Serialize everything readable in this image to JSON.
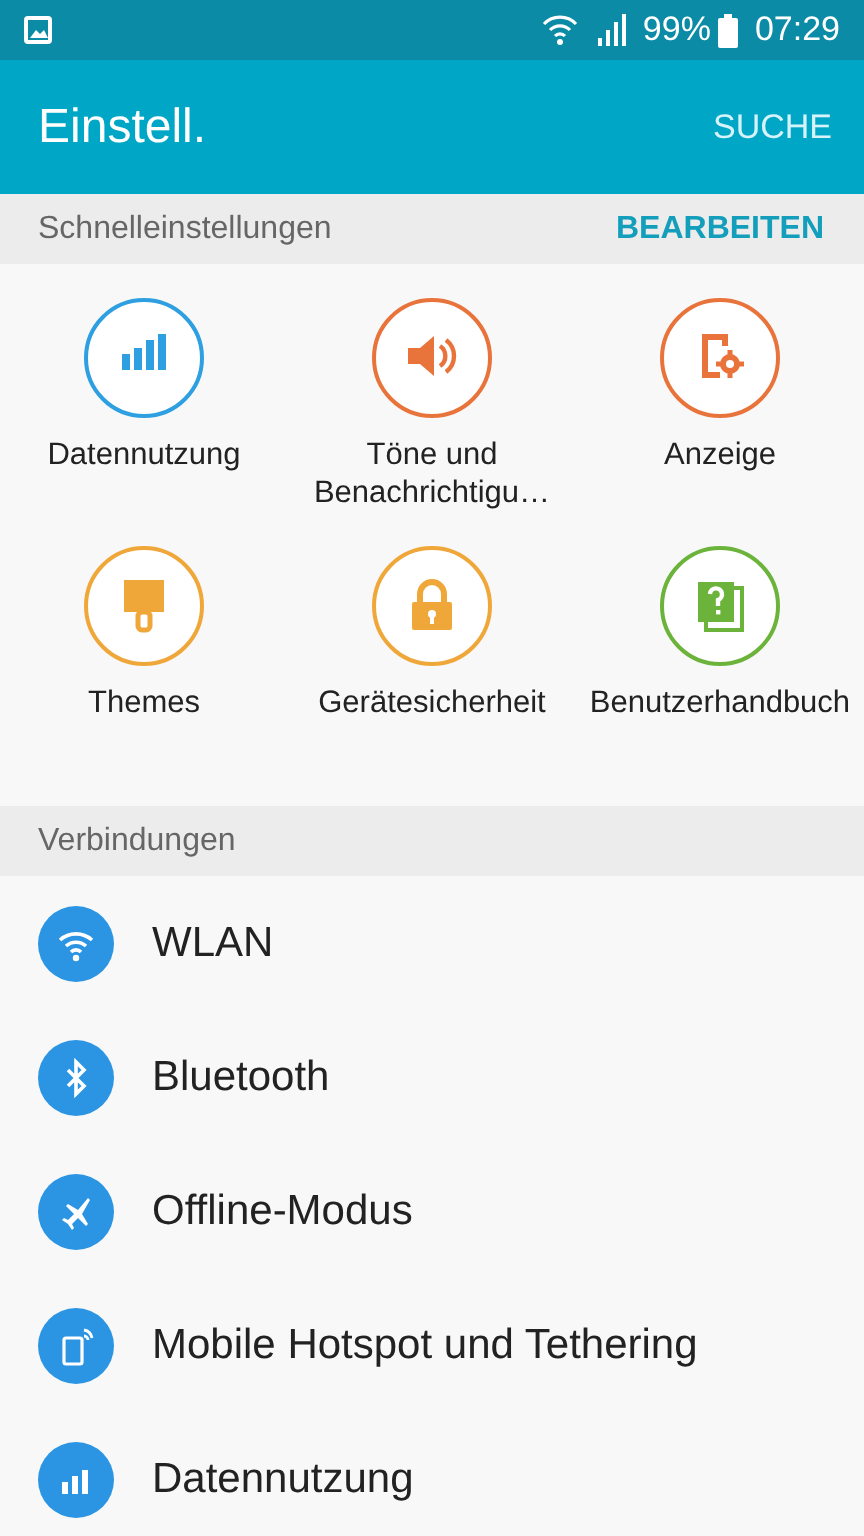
{
  "status_bar": {
    "battery": "99%",
    "time": "07:29"
  },
  "app_bar": {
    "title": "Einstell.",
    "action": "SUCHE"
  },
  "quick_settings": {
    "title": "Schnelleinstellungen",
    "action": "BEARBEITEN",
    "tiles": [
      {
        "kind": "data",
        "label": "Datennutzung",
        "color": "#2e9fe0"
      },
      {
        "kind": "sound",
        "label": "Töne und Benachrichtigu…",
        "color": "#e8743b"
      },
      {
        "kind": "display",
        "label": "Anzeige",
        "color": "#e8743b"
      },
      {
        "kind": "themes",
        "label": "Themes",
        "color": "#f0a73a"
      },
      {
        "kind": "lock",
        "label": "Gerätesicherheit",
        "color": "#f0a73a"
      },
      {
        "kind": "manual",
        "label": "Benutzerhandbuch",
        "color": "#6bb33a"
      }
    ]
  },
  "connections": {
    "title": "Verbindungen",
    "items": [
      {
        "kind": "wifi",
        "label": "WLAN"
      },
      {
        "kind": "bluetooth",
        "label": "Bluetooth"
      },
      {
        "kind": "airplane",
        "label": "Offline-Modus"
      },
      {
        "kind": "hotspot",
        "label": "Mobile Hotspot und Tethering"
      },
      {
        "kind": "data",
        "label": "Datennutzung"
      }
    ]
  }
}
